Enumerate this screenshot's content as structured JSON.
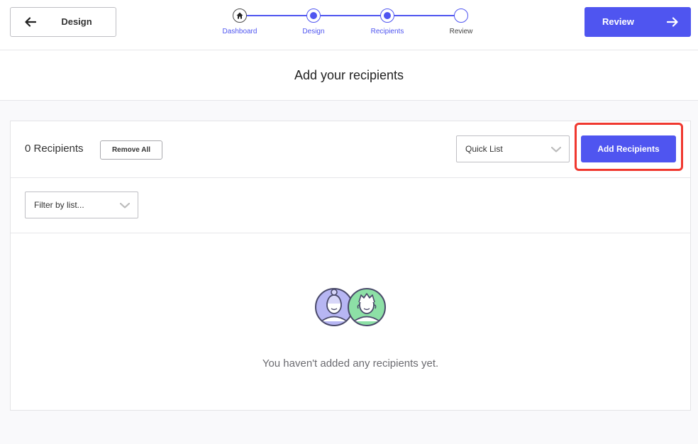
{
  "header": {
    "back_label": "Design",
    "review_label": "Review",
    "accent_color": "#4f55f0"
  },
  "stepper": {
    "steps": [
      {
        "label": "Dashboard",
        "state": "home"
      },
      {
        "label": "Design",
        "state": "done"
      },
      {
        "label": "Recipients",
        "state": "current"
      },
      {
        "label": "Review",
        "state": "pending"
      }
    ]
  },
  "page": {
    "title": "Add your recipients"
  },
  "recipients": {
    "count_label": "0 Recipients",
    "remove_all_label": "Remove All",
    "quick_list_value": "Quick List",
    "add_label": "Add Recipients",
    "filter_placeholder": "Filter by list...",
    "empty_message": "You haven't added any recipients yet."
  },
  "icons": [
    "left-arrow-icon",
    "right-arrow-icon",
    "home-icon",
    "chevron-down-icon",
    "recipients-avatar-icon"
  ]
}
